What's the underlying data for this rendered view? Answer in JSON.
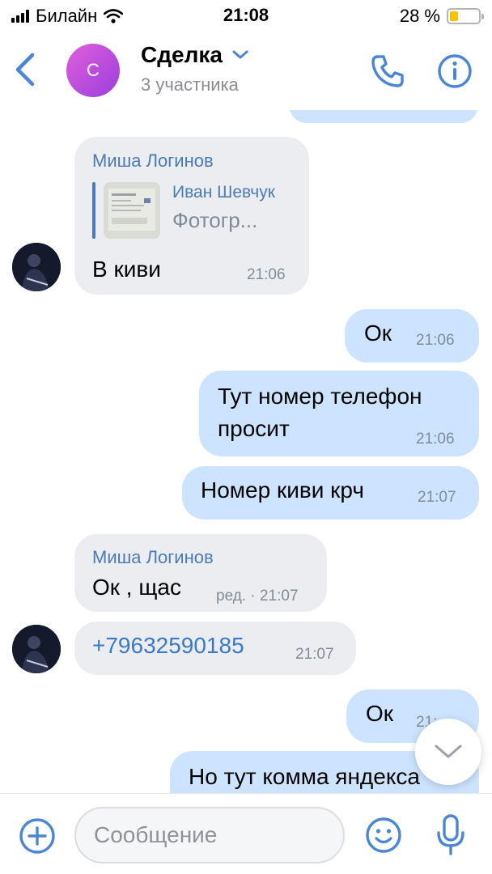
{
  "status": {
    "carrier": "Билайн",
    "time": "21:08",
    "battery": "28 %",
    "battery_level": 0.28
  },
  "header": {
    "avatar_letter": "С",
    "title": "Сделка",
    "subtitle": "3 участника",
    "icons": {
      "back": "back-chevron-icon",
      "dropdown": "chevron-down-icon",
      "call": "phone-icon",
      "info": "info-icon"
    }
  },
  "messages": [
    {
      "type": "in",
      "sender": "Миша Логинов",
      "forward": {
        "name": "Иван Шевчук",
        "text": "Фотогр..."
      },
      "text": "В киви",
      "time": "21:06"
    },
    {
      "type": "out",
      "text": "Ок",
      "time": "21:06"
    },
    {
      "type": "out",
      "text_line1": "Тут номер телефон",
      "text_line2": "просит",
      "time": "21:06"
    },
    {
      "type": "out",
      "text": "Номер киви крч",
      "time": "21:07"
    },
    {
      "type": "in",
      "sender": "Миша Логинов",
      "text": "Ок , щас",
      "time": "ред. · 21:07"
    },
    {
      "type": "in",
      "text": "+79632590185",
      "time": "21:07",
      "is_link": true
    },
    {
      "type": "out",
      "text": "Ок",
      "time": "21:"
    },
    {
      "type": "out",
      "text": "Но тут комма яндекса"
    }
  ],
  "input": {
    "placeholder": "Сообщение",
    "value": ""
  },
  "colors": {
    "accent": "#4a86d3",
    "incoming": "#ecedf0",
    "outgoing": "#cce4ff",
    "link": "#3a78c9"
  }
}
